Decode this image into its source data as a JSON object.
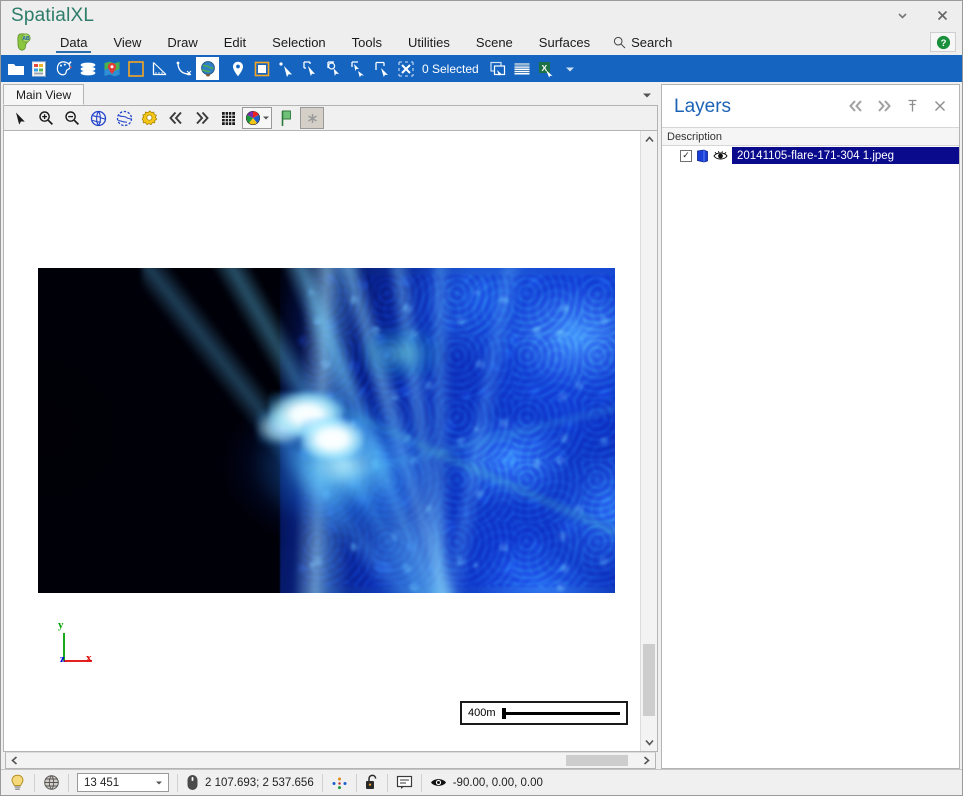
{
  "window": {
    "title": "SpatialXL",
    "minimize_label": "▾",
    "close_label": "✕"
  },
  "menubar": {
    "logo_icon": "globe-africa-ab-icon",
    "items": [
      {
        "label": "Data",
        "active": true
      },
      {
        "label": "View",
        "active": false
      },
      {
        "label": "Draw",
        "active": false
      },
      {
        "label": "Edit",
        "active": false
      },
      {
        "label": "Selection",
        "active": false
      },
      {
        "label": "Tools",
        "active": false
      },
      {
        "label": "Utilities",
        "active": false
      },
      {
        "label": "Scene",
        "active": false
      },
      {
        "label": "Surfaces",
        "active": false
      }
    ],
    "search_label": "Search",
    "search_icon": "magnifier-icon",
    "help_icon": "help-question-icon"
  },
  "ribbon": {
    "selected_count_label": "0 Selected",
    "buttons": [
      {
        "name": "open-folder-button",
        "icon": "folder-icon"
      },
      {
        "name": "data-table-button",
        "icon": "table-window-icon"
      },
      {
        "name": "symbology-button",
        "icon": "palette-icon"
      },
      {
        "name": "layers-stack-button",
        "icon": "layers-stack-icon"
      },
      {
        "name": "map-pin-button",
        "icon": "map-pin-icon"
      },
      {
        "name": "borehole-button",
        "icon": "borehole-icon"
      },
      {
        "name": "measure-angle-button",
        "icon": "angle-ruler-icon"
      },
      {
        "name": "clear-measure-button",
        "icon": "arc-clear-icon"
      },
      {
        "name": "globe-button",
        "icon": "globe-icon",
        "selected": true
      },
      {
        "name": "place-point-button",
        "icon": "pin-drop-icon"
      },
      {
        "name": "select-area-button",
        "icon": "area-select-icon"
      },
      {
        "name": "select-pointer-button",
        "icon": "pointer-point-icon"
      },
      {
        "name": "select-rect-button",
        "icon": "rect-select-icon"
      },
      {
        "name": "select-circle-button",
        "icon": "circle-select-icon"
      },
      {
        "name": "select-lasso-button",
        "icon": "lasso-select-icon"
      },
      {
        "name": "select-polygon-button",
        "icon": "polygon-select-icon"
      },
      {
        "name": "clear-selection-button",
        "icon": "clear-selection-x-icon"
      },
      {
        "name": "copy-selection-button",
        "icon": "copy-window-icon"
      },
      {
        "name": "selection-table-button",
        "icon": "spreadsheet-rows-icon"
      },
      {
        "name": "export-excel-button",
        "icon": "excel-export-icon"
      },
      {
        "name": "ribbon-overflow-button",
        "icon": "chevron-down-icon"
      }
    ]
  },
  "view": {
    "tab_label": "Main View",
    "tab_menu_icon": "chevron-down-icon",
    "toolbar": [
      {
        "name": "pointer-tool",
        "icon": "arrow-pointer-icon"
      },
      {
        "name": "zoom-in-tool",
        "icon": "magnifier-plus-icon"
      },
      {
        "name": "zoom-out-tool",
        "icon": "magnifier-minus-icon"
      },
      {
        "name": "zoom-extent-tool",
        "icon": "globe-blue-icon"
      },
      {
        "name": "zoom-previous-tool",
        "icon": "globe-blue-dashed-icon"
      },
      {
        "name": "view-settings-tool",
        "icon": "gear-yellow-icon"
      },
      {
        "name": "step-back-tool",
        "icon": "double-chevron-left-icon"
      },
      {
        "name": "step-forward-tool",
        "icon": "double-chevron-right-icon"
      },
      {
        "name": "grid-tool",
        "icon": "grid-icon"
      },
      {
        "name": "color-legend-tool",
        "icon": "color-wheel-icon"
      },
      {
        "name": "bookmark-tool",
        "icon": "green-flag-icon"
      },
      {
        "name": "more-tools",
        "icon": "asterisk-icon"
      }
    ],
    "raster_layer_name": "20141105-flare-171-304 1.jpeg",
    "axis_triad": {
      "x": "x",
      "y": "y",
      "z": "z"
    },
    "scalebar_label": "400m"
  },
  "layers_panel": {
    "title": "Layers",
    "header_buttons": [
      {
        "name": "collapse-all-button",
        "icon": "double-chevron-left-icon"
      },
      {
        "name": "expand-all-button",
        "icon": "double-chevron-right-icon"
      },
      {
        "name": "pin-panel-button",
        "icon": "pin-icon"
      },
      {
        "name": "close-panel-button",
        "icon": "close-x-icon"
      }
    ],
    "column_header": "Description",
    "rows": [
      {
        "checked": true,
        "checkmark": "✓",
        "type_icon": "raster-layer-icon",
        "visibility_icon": "eye-icon",
        "name": "20141105-flare-171-304 1.jpeg",
        "selected": true
      }
    ]
  },
  "statusbar": {
    "hint_icon": "lightbulb-icon",
    "projection_icon": "globe-wire-icon",
    "scale_value": "13 451",
    "scale_caret": "▾",
    "cursor_icon": "mouse-icon",
    "coordinates": "2 107.693; 2 537.656",
    "snap_icon": "snap-points-icon",
    "lock_icon": "unlocked-padlock-icon",
    "notes_icon": "message-icon",
    "orientation_icon": "eye-icon",
    "orientation_value": "-90.00, 0.00, 0.00"
  },
  "colors": {
    "ribbon_blue": "#1565c0",
    "title_green": "#2d7d6a",
    "panel_title_blue": "#1d63b5",
    "selection_navy": "#0a0a8c",
    "menu_underline": "#2b6cb0"
  }
}
